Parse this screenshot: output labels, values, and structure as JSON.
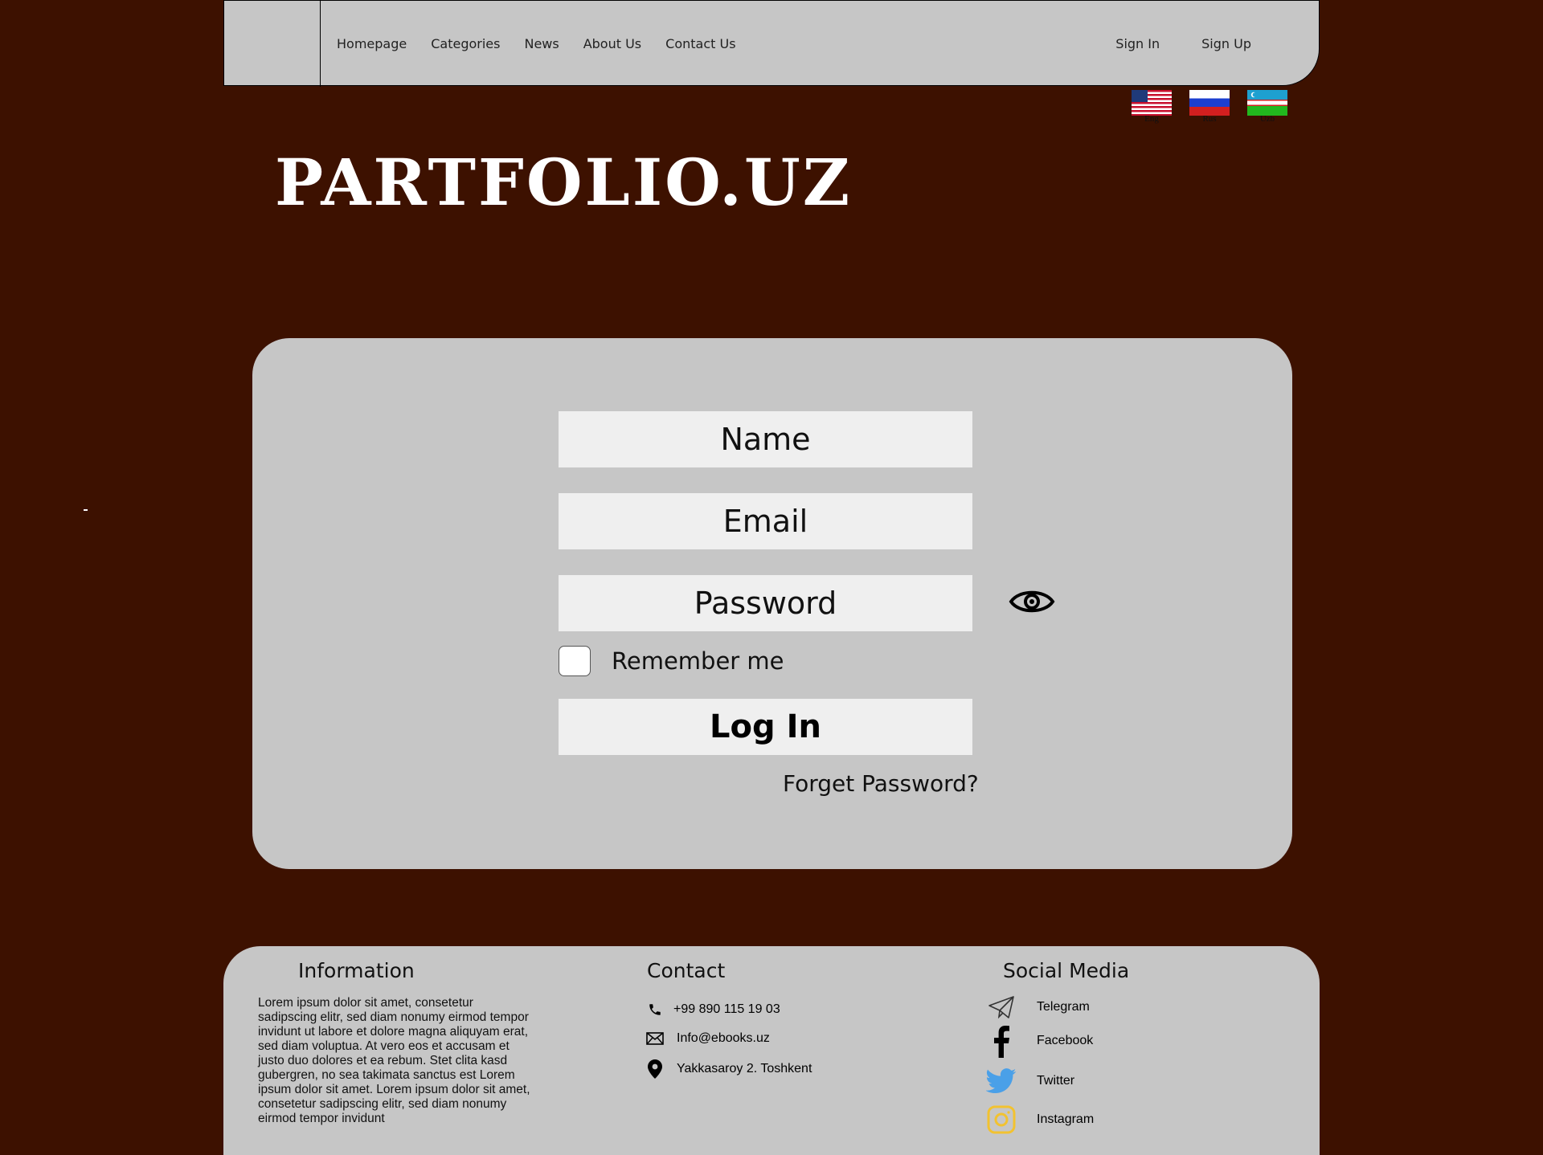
{
  "header": {
    "nav": [
      "Homepage",
      "Categories",
      "News",
      "About Us",
      "Contact Us"
    ],
    "sign_in": "Sign In",
    "sign_up": "Sign Up"
  },
  "languages": [
    {
      "label": "Eng",
      "icon": "us-flag-icon"
    },
    {
      "label": "Rus",
      "icon": "russia-flag-icon"
    },
    {
      "label": "Uzb",
      "icon": "uzbekistan-flag-icon"
    }
  ],
  "brand": "PARTFOLIO.UZ",
  "form": {
    "name_placeholder": "Name",
    "email_placeholder": "Email",
    "password_placeholder": "Password",
    "remember_label": "Remember me",
    "login_label": "Log In",
    "forgot_label": "Forget Password?"
  },
  "footer": {
    "information": {
      "title": "Information",
      "text": "Lorem ipsum dolor sit amet, consetetur sadipscing elitr, sed diam nonumy eirmod tempor invidunt ut labore et dolore magna aliquyam erat, sed diam voluptua. At vero eos et accusam et justo duo dolores et ea rebum. Stet clita kasd gubergren, no sea takimata sanctus est Lorem ipsum dolor sit amet. Lorem ipsum dolor sit amet, consetetur sadipscing elitr, sed diam nonumy eirmod tempor invidunt"
    },
    "contact": {
      "title": "Contact",
      "phone": "+99 890 115 19 03",
      "email": "Info@ebooks.uz",
      "address": "Yakkasaroy 2. Toshkent"
    },
    "social": {
      "title": "Social Media",
      "items": [
        "Telegram",
        "Facebook",
        "Twitter",
        "Instagram"
      ]
    }
  },
  "colors": {
    "background": "#3d1100",
    "panel": "#c6c6c6",
    "field": "#efefef",
    "twitter": "#4aa0e8",
    "instagram": "#f2c230"
  }
}
